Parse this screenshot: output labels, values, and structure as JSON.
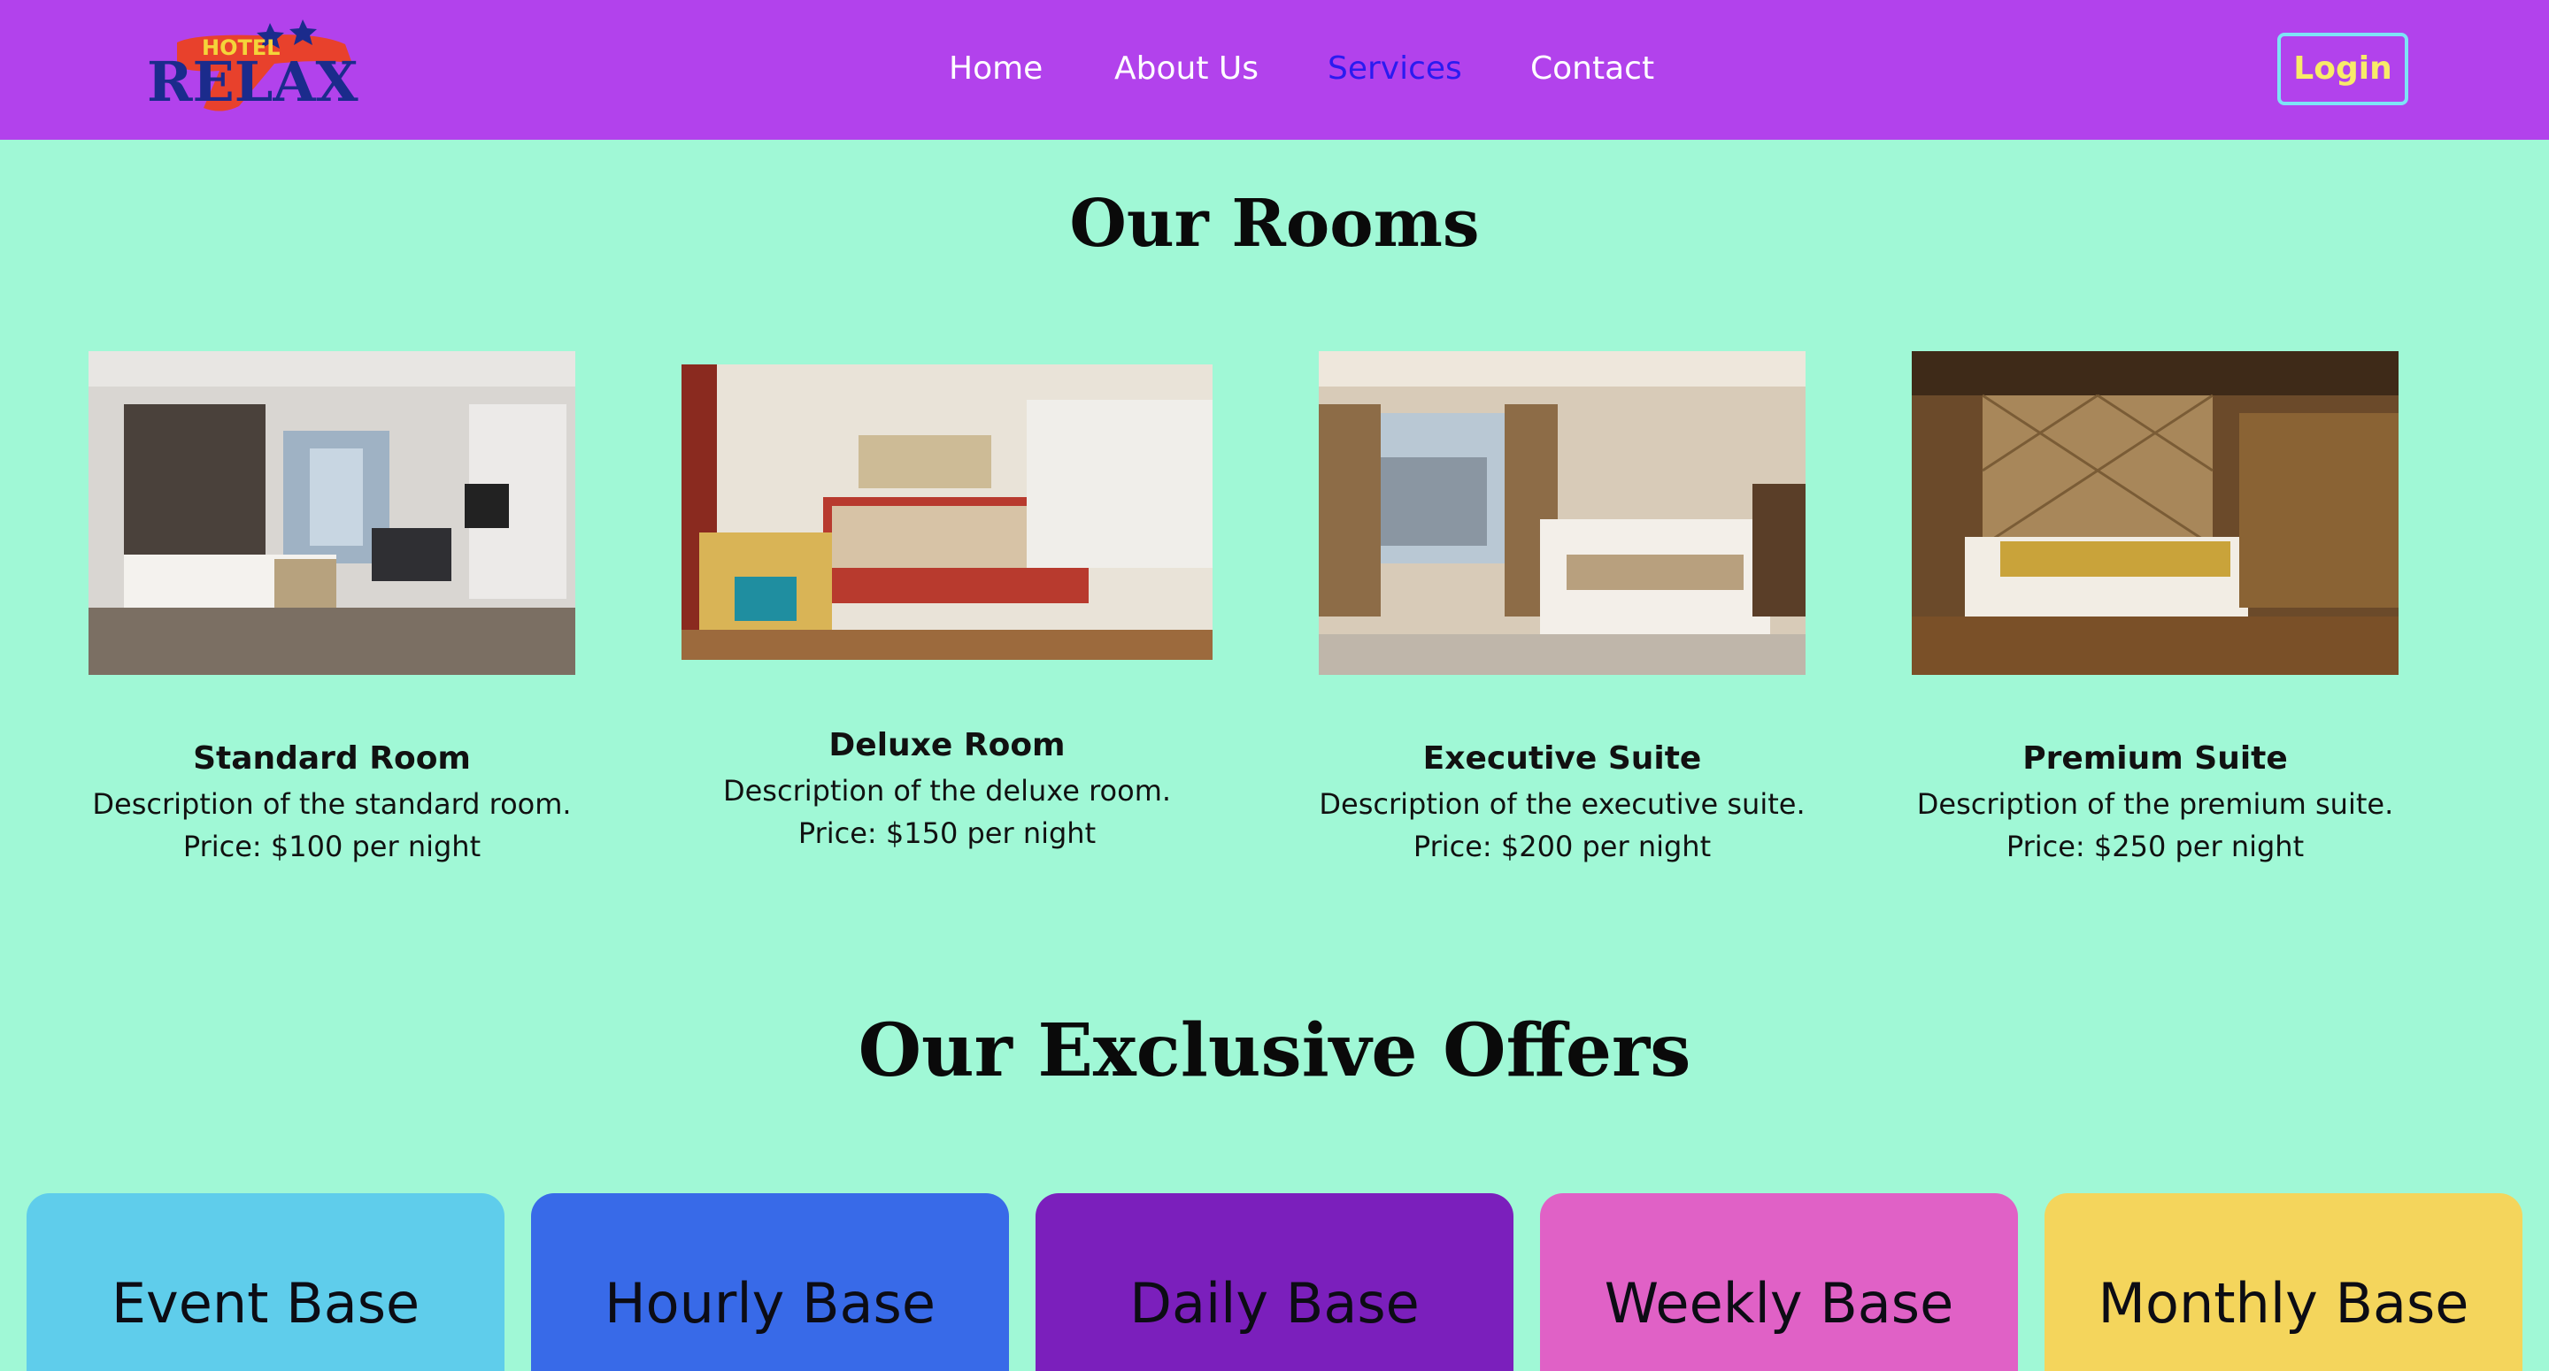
{
  "header": {
    "logo": {
      "top_text": "HOTEL",
      "main_text": "RELAX"
    },
    "nav": [
      {
        "label": "Home",
        "active": false
      },
      {
        "label": "About Us",
        "active": false
      },
      {
        "label": "Services",
        "active": true
      },
      {
        "label": "Contact",
        "active": false
      }
    ],
    "login_label": "Login"
  },
  "rooms_section": {
    "title": "Our Rooms",
    "rooms": [
      {
        "name": "Standard Room",
        "description": "Description of the standard room.",
        "price": "Price: $100 per night"
      },
      {
        "name": "Deluxe Room",
        "description": "Description of the deluxe room.",
        "price": "Price: $150 per night"
      },
      {
        "name": "Executive Suite",
        "description": "Description of the executive suite.",
        "price": "Price: $200 per night"
      },
      {
        "name": "Premium Suite",
        "description": "Description of the premium suite.",
        "price": "Price: $250 per night"
      }
    ]
  },
  "offers_section": {
    "title": "Our Exclusive Offers",
    "offers": [
      {
        "label": "Event Base",
        "color": "#5fcdeb"
      },
      {
        "label": "Hourly Base",
        "color": "#386ae8"
      },
      {
        "label": "Daily Base",
        "color": "#7b1fbc"
      },
      {
        "label": "Weekly Base",
        "color": "#e061c6"
      },
      {
        "label": "Monthly Base",
        "color": "#f4d55c"
      }
    ]
  },
  "colors": {
    "nav_bg": "#b242ec",
    "page_bg": "#a0f8d6",
    "active_link": "#2b1bf0",
    "login_border": "#7de3f6",
    "login_text": "#f8eb68"
  }
}
